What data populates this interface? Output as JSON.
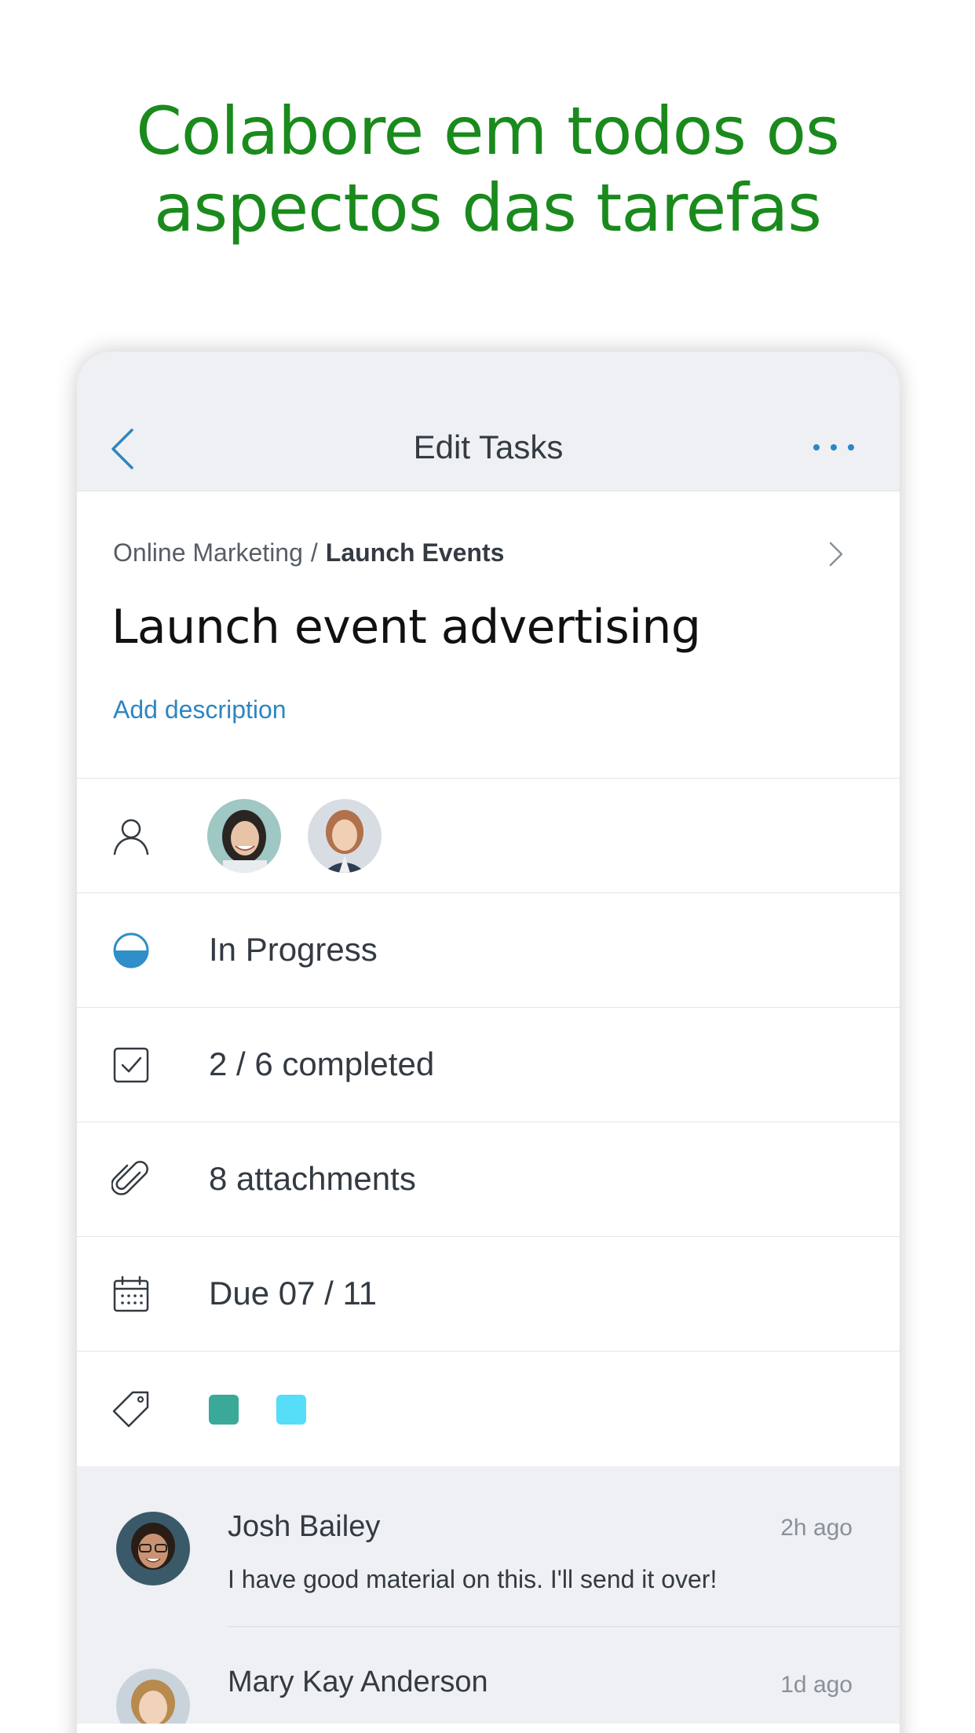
{
  "headline": {
    "line1": "Colabore em todos os",
    "line2": "aspectos das tarefas"
  },
  "colors": {
    "accent_green": "#1a8a1c",
    "link_blue": "#2e86c1",
    "tag1": "#3aa99a",
    "tag2": "#56ddf8",
    "status_blue": "#2e8fc9"
  },
  "navbar": {
    "back_icon": "chevron-left-icon",
    "title": "Edit Tasks",
    "more_icon": "more-dots-icon"
  },
  "breadcrumb": {
    "parent": "Online Marketing",
    "separator": "/",
    "current": "Launch Events"
  },
  "task": {
    "title": "Launch event advertising",
    "add_description": "Add description"
  },
  "rows": {
    "assignees": {
      "icon": "person-icon"
    },
    "status": {
      "icon": "progress-half-icon",
      "label": "In Progress"
    },
    "checklist": {
      "icon": "checkbox-icon",
      "label": "2 / 6 completed"
    },
    "attachments": {
      "icon": "paperclip-icon",
      "label": "8 attachments"
    },
    "due": {
      "icon": "calendar-icon",
      "label": "Due 07 / 11"
    },
    "labels": {
      "icon": "tag-icon"
    }
  },
  "comments": [
    {
      "name": "Josh Bailey",
      "time": "2h ago",
      "text": "I have good material on this. I'll send it over!"
    },
    {
      "name": "Mary Kay Anderson",
      "time": "1d ago",
      "text": ""
    }
  ]
}
